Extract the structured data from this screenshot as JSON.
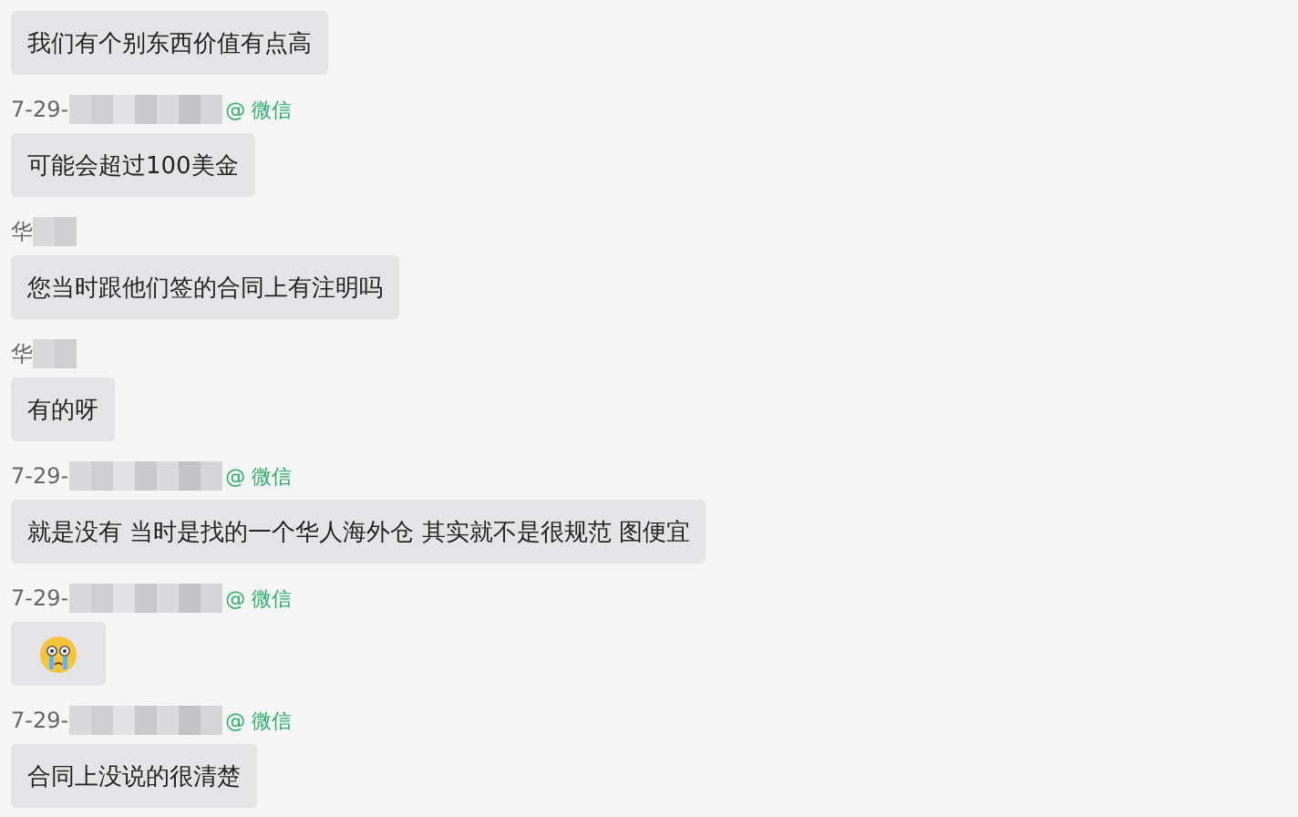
{
  "messages": [
    {
      "kind": "text",
      "text": "我们有个别东西价值有点高"
    },
    {
      "sender": {
        "kind": "wechat",
        "prefix": "7-29-",
        "tag": "@ 微信"
      },
      "kind": "text",
      "text": "可能会超过100美金"
    },
    {
      "sender": {
        "kind": "plain",
        "prefix": "华"
      },
      "kind": "text",
      "text": "您当时跟他们签的合同上有注明吗"
    },
    {
      "sender": {
        "kind": "plain",
        "prefix": "华"
      },
      "kind": "text",
      "text": "有的呀"
    },
    {
      "sender": {
        "kind": "wechat",
        "prefix": "7-29-",
        "tag": "@ 微信"
      },
      "kind": "text",
      "text": "就是没有 当时是找的一个华人海外仓 其实就不是很规范 图便宜"
    },
    {
      "sender": {
        "kind": "wechat",
        "prefix": "7-29-",
        "tag": "@ 微信"
      },
      "kind": "emoji"
    },
    {
      "sender": {
        "kind": "wechat",
        "prefix": "7-29-",
        "tag": "@ 微信"
      },
      "kind": "text",
      "text": "合同上没说的很清楚"
    }
  ]
}
